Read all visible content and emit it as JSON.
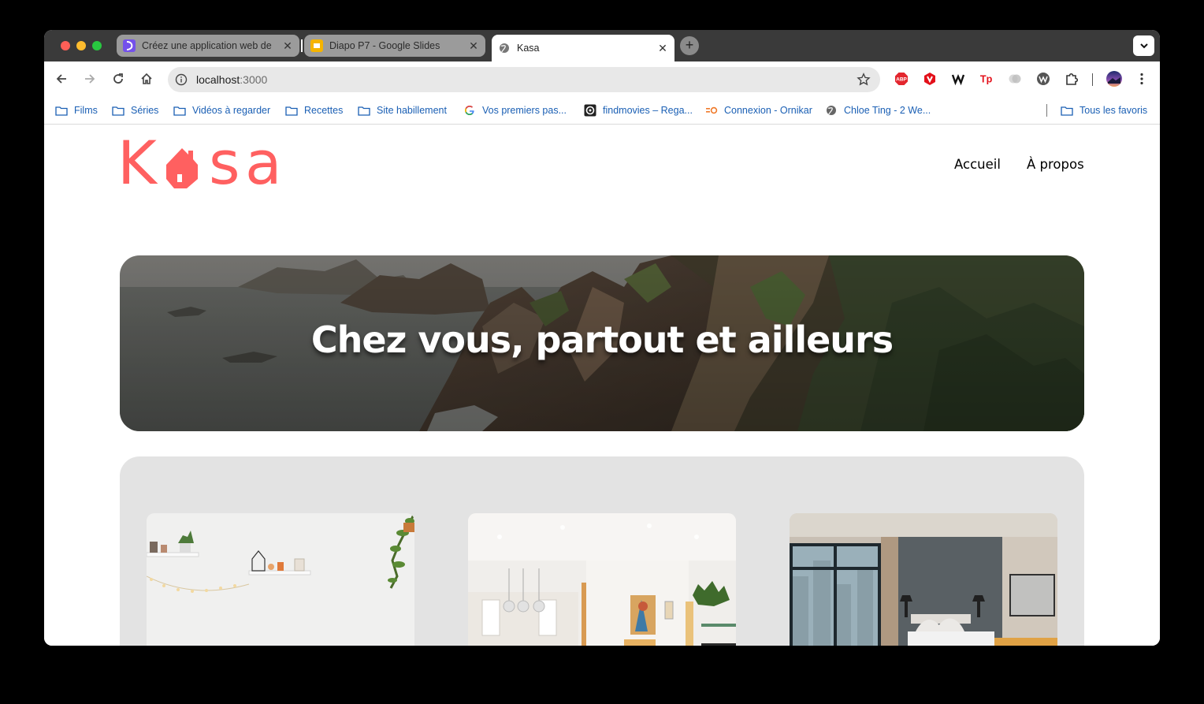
{
  "browser": {
    "tabs": [
      {
        "title": "Créez une application web de",
        "favicon": "openclassrooms-icon",
        "active": false
      },
      {
        "title": "Diapo P7 - Google Slides",
        "favicon": "google-slides-icon",
        "active": false
      },
      {
        "title": "Kasa",
        "favicon": "globe-icon",
        "active": true
      }
    ],
    "close_glyph": "✕",
    "new_tab_glyph": "+",
    "url_host": "localhost",
    "url_port": ":3000",
    "bookmarks": [
      {
        "label": "Films",
        "icon": "folder-icon"
      },
      {
        "label": "Séries",
        "icon": "folder-icon"
      },
      {
        "label": "Vidéos à regarder",
        "icon": "folder-icon"
      },
      {
        "label": "Recettes",
        "icon": "folder-icon"
      },
      {
        "label": "Site habillement",
        "icon": "folder-icon"
      },
      {
        "label": "Vos premiers pas...",
        "icon": "google-icon"
      },
      {
        "label": "findmovies – Rega...",
        "icon": "findmovies-icon"
      },
      {
        "label": "Connexion - Ornikar",
        "icon": "ornikar-icon"
      },
      {
        "label": "Chloe Ting - 2 We...",
        "icon": "globe-icon"
      }
    ],
    "all_bookmarks_label": "Tous les favoris",
    "extensions": [
      "adblock-plus-icon",
      "vivaldi-icon",
      "wikiwand-icon",
      "tp-icon",
      "cloud-icon",
      "wappalyzer-icon",
      "puzzle-icon",
      "profile-avatar"
    ]
  },
  "site": {
    "brand": "Kasa",
    "logo_letters": {
      "k": "K",
      "s": "s",
      "a": "a"
    },
    "brand_color": "#FF6060",
    "nav": {
      "home": "Accueil",
      "about": "À propos"
    },
    "banner_title": "Chez vous, partout et ailleurs",
    "cards": [
      {
        "image": "white-wall-shelves-photo"
      },
      {
        "image": "bright-living-room-photo"
      },
      {
        "image": "hotel-bedroom-photo"
      }
    ]
  }
}
